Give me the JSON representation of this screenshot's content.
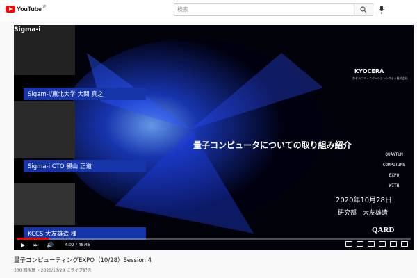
{
  "header": {
    "logo_text": "YouTube",
    "logo_region": "JP",
    "search_placeholder": "検索"
  },
  "player": {
    "left_panel": {
      "sigma_logo": "Sigma-i",
      "nameplates": [
        "Sigam-i/東北大学 大関 真之",
        "Sigma-i CTO 観山 正道",
        "KCCS 大友雄造 様"
      ]
    },
    "slide": {
      "brand": "KYOCERA",
      "brand_sub": "京セラコミュニケーションシステム株式会社",
      "title": "量子コンピュータについての取り組み紹介",
      "event_words": [
        "QUANTUM",
        "COMPUTING",
        "EXPO",
        "WITH"
      ],
      "date": "2020年10月28日",
      "dept": "研究部　大友雄造",
      "sponsor": "QARD"
    },
    "controls": {
      "time": "4:02 / 48:45",
      "progress": 0.083
    }
  },
  "video": {
    "title": "量子コンピューティングEXPO（10/28）Session 4",
    "meta": "300 回視聴 • 2020/10/28 にライブ配信"
  },
  "colors": {
    "brand_red": "#ff0000",
    "nameplate_blue": "#1535a8"
  }
}
